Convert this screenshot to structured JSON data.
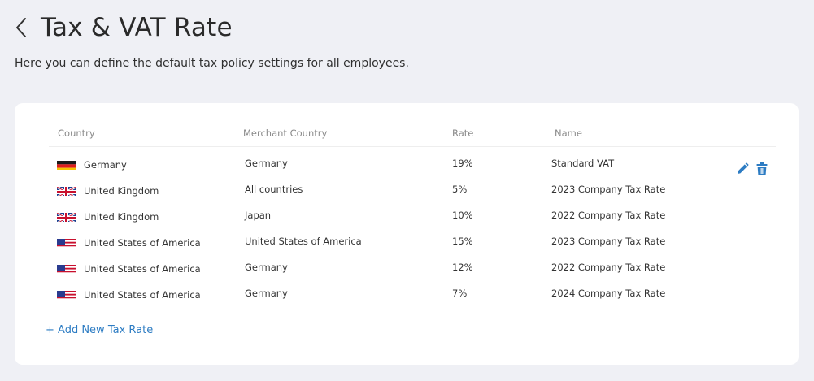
{
  "header": {
    "title": "Tax & VAT Rate",
    "subtitle": "Here you can define the default tax policy settings for all employees."
  },
  "table": {
    "columns": {
      "country": "Country",
      "merchant_country": "Merchant Country",
      "rate": "Rate",
      "name": "Name"
    },
    "rows": [
      {
        "country": "Germany",
        "flag": "germany-flag-icon",
        "merchant_country": "Germany",
        "rate": "19%",
        "name": "Standard VAT"
      },
      {
        "country": "United Kingdom",
        "flag": "uk-flag-icon",
        "merchant_country": "All countries",
        "rate": "5%",
        "name": "2023 Company Tax Rate"
      },
      {
        "country": "United Kingdom",
        "flag": "uk-flag-icon",
        "merchant_country": "Japan",
        "rate": "10%",
        "name": "2022 Company Tax Rate"
      },
      {
        "country": "United States of America",
        "flag": "usa-flag-icon",
        "merchant_country": "United States of America",
        "rate": "15%",
        "name": "2023 Company Tax Rate"
      },
      {
        "country": "United States of America",
        "flag": "usa-flag-icon",
        "merchant_country": "Germany",
        "rate": "12%",
        "name": "2022 Company Tax Rate"
      },
      {
        "country": "United States of America",
        "flag": "usa-flag-icon",
        "merchant_country": "Germany",
        "rate": "7%",
        "name": "2024 Company Tax Rate"
      }
    ],
    "row_actions": [
      "pencil-icon",
      "trash-icon"
    ]
  },
  "add_button": {
    "label": "+ Add New Tax Rate"
  },
  "colors": {
    "background": "#eff0f5",
    "card": "#ffffff",
    "accent": "#2d7cc3"
  }
}
